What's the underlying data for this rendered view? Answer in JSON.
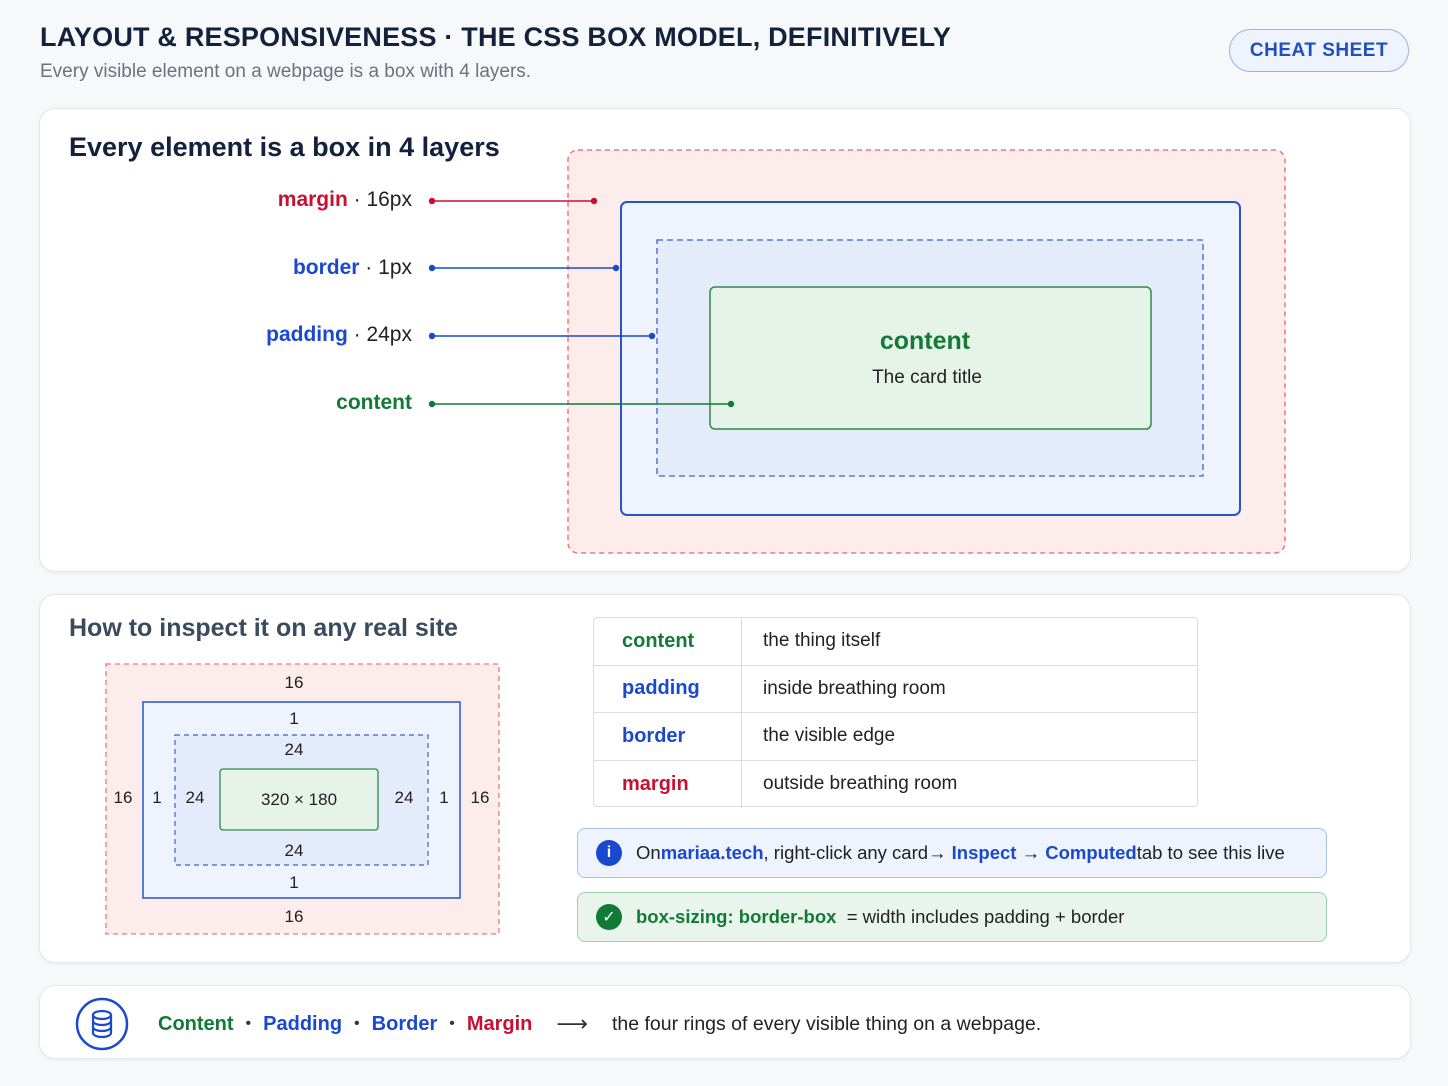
{
  "header": {
    "title": "LAYOUT & RESPONSIVENESS · THE CSS BOX MODEL, DEFINITIVELY",
    "subtitle": "Every visible element on a webpage is a box with 4 layers.",
    "cheat_sheet_label": "CHEAT SHEET"
  },
  "diagram": {
    "heading": "Every element is a box in 4 layers",
    "labels": [
      {
        "name": "margin",
        "value": "16px",
        "color": "#c8102e"
      },
      {
        "name": "border",
        "value": "1px",
        "color": "#1a49d0"
      },
      {
        "name": "padding",
        "value": "24px",
        "color": "#1a49d0"
      },
      {
        "name": "content",
        "value": "",
        "color": "#117a34"
      }
    ],
    "content_box_title": "content",
    "content_box_text": "The card title"
  },
  "inspect": {
    "heading": "How to inspect it on any real site",
    "mini": {
      "margin_top": "16",
      "border_top": "1",
      "padding_top": "24",
      "margin_left": "16",
      "border_left": "1",
      "padding_left": "24",
      "content_size": "320 × 180",
      "padding_right": "24",
      "border_right": "1",
      "margin_right": "16",
      "padding_bottom": "24",
      "border_bottom": "1",
      "margin_bottom": "16"
    },
    "table": [
      {
        "term": "content",
        "desc": "the thing itself",
        "color": "#117a34"
      },
      {
        "term": "padding",
        "desc": "inside breathing room",
        "color": "#1a49d0"
      },
      {
        "term": "border",
        "desc": "the visible edge",
        "color": "#1a49d0"
      },
      {
        "term": "margin",
        "desc": "outside breathing room",
        "color": "#c8102e"
      }
    ],
    "info_note": {
      "p1": "On ",
      "site": "mariaa.tech",
      "p2": ", right-click any card ",
      "arrow1": "→",
      "inspect": "Inspect",
      "arrow2": "→",
      "computed": "Computed",
      "p3": " tab to see this live"
    },
    "ok_note": {
      "code": "box-sizing: border-box",
      "text": "= width includes padding + border"
    }
  },
  "footer": {
    "items": [
      {
        "label": "Content",
        "color": "#117a34"
      },
      {
        "label": "Padding",
        "color": "#1a49d0"
      },
      {
        "label": "Border",
        "color": "#1a49d0"
      },
      {
        "label": "Margin",
        "color": "#c8102e"
      }
    ],
    "separator": "•",
    "arrow": "⟶",
    "text": "the four rings of every visible thing on a webpage.",
    "icon": "stack-icon"
  },
  "colors": {
    "margin": "#c8102e",
    "border": "#1a49d0",
    "padding": "#1a49d0",
    "content": "#117a34"
  }
}
